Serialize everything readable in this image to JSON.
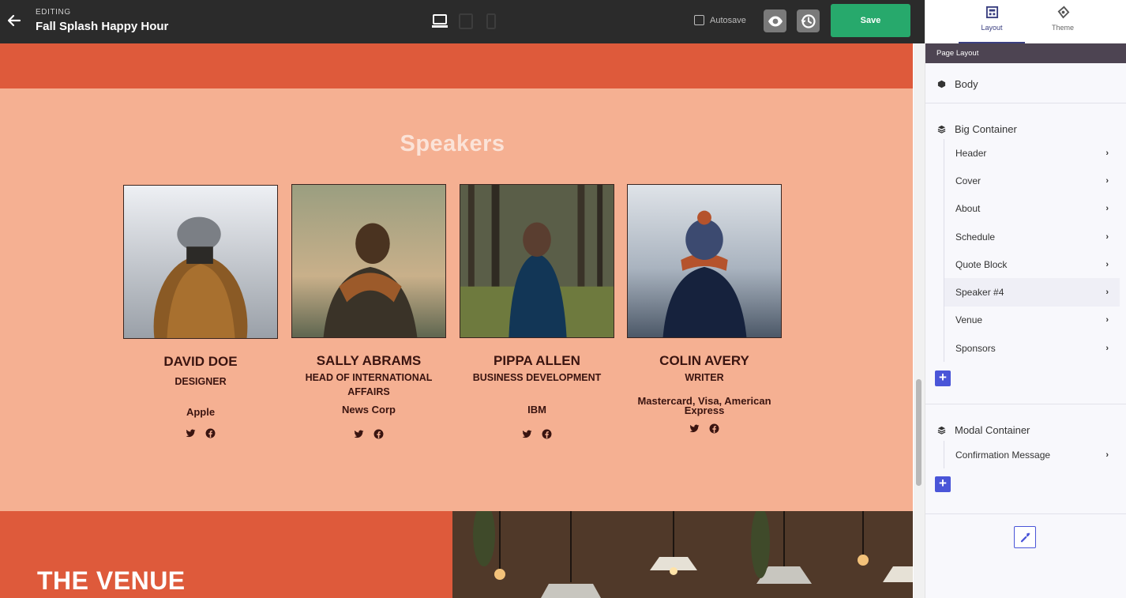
{
  "topbar": {
    "editing_label": "EDITING",
    "title": "Fall Splash Happy Hour",
    "autosave_label": "Autosave",
    "save_label": "Save"
  },
  "canvas": {
    "speakers_heading": "Speakers",
    "speakers": [
      {
        "name": "DAVID DOE",
        "role": "DESIGNER",
        "company": "Apple"
      },
      {
        "name": "SALLY ABRAMS",
        "role": "HEAD OF INTERNATIONAL AFFAIRS",
        "company": "News Corp"
      },
      {
        "name": "PIPPA ALLEN",
        "role": "BUSINESS DEVELOPMENT",
        "company": "IBM"
      },
      {
        "name": "COLIN AVERY",
        "role": "WRITER",
        "company": "Mastercard, Visa, American Express"
      }
    ],
    "venue_heading": "THE VENUE"
  },
  "panel": {
    "tabs": [
      {
        "label": "Layout",
        "icon": "layout-icon",
        "active": true
      },
      {
        "label": "Theme",
        "icon": "theme-icon",
        "active": false
      }
    ],
    "header": "Page Layout",
    "body_label": "Body",
    "big_container": {
      "label": "Big Container",
      "items": [
        "Header",
        "Cover",
        "About",
        "Schedule",
        "Quote Block",
        "Speaker #4",
        "Venue",
        "Sponsors"
      ]
    },
    "modal_container": {
      "label": "Modal Container",
      "items": [
        "Confirmation Message"
      ]
    }
  },
  "colors": {
    "accent_green": "#27a96c",
    "accent_blue": "#4a55d8",
    "orange": "#de5a3b",
    "peach": "#f5b092"
  }
}
